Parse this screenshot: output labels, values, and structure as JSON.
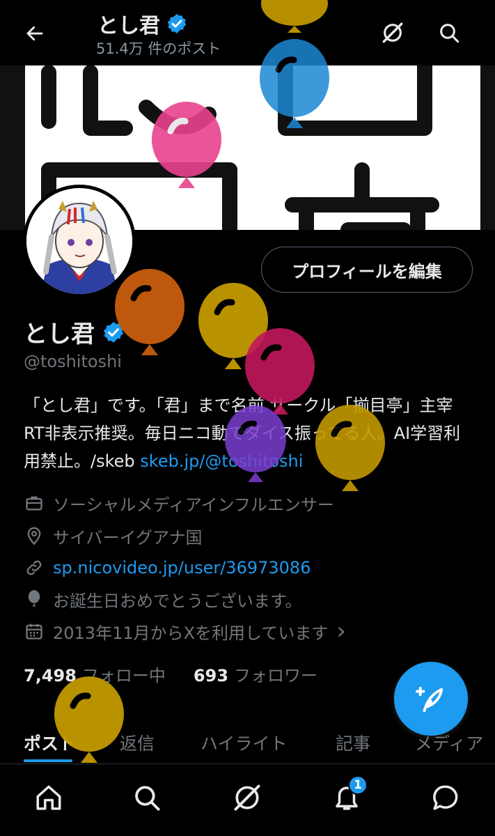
{
  "header": {
    "name": "とし君",
    "post_count": "51.4万 件のポスト",
    "icons": [
      "back-arrow-icon",
      "grok-icon",
      "search-icon"
    ]
  },
  "banner": {
    "text": "揃目亭",
    "colors": {
      "bg": "#ffffff",
      "fg": "#111111"
    }
  },
  "profile": {
    "display_name": "とし君",
    "handle": "@toshitoshi",
    "edit_button": "プロフィールを編集",
    "bio_text": "「とし君」です。「君」まで名前 サークル「揃目亭」主宰 RT非表示推奨。毎日ニコ動でダイス振ってる人。AI学習利用禁止。/skeb ",
    "bio_link": "skeb.jp/@toshitoshi",
    "category": "ソーシャルメディアインフルエンサー",
    "location": "サイバーイグアナ国",
    "website": "sp.nicovideo.jp/user/36973086",
    "birthday": "お誕生日おめでとうございます。",
    "joined": "2013年11月からXを利用しています",
    "joined_chevron": "›"
  },
  "stats": {
    "following_count": "7,498",
    "following_label": "フォロー中",
    "followers_count": "693",
    "followers_label": "フォロワー"
  },
  "tabs": [
    {
      "label": "ポスト",
      "active": true
    },
    {
      "label": "返信",
      "active": false
    },
    {
      "label": "ハイライト",
      "active": false
    },
    {
      "label": "記事",
      "active": false
    },
    {
      "label": "メディア",
      "active": false
    }
  ],
  "bottom_nav": {
    "items": [
      "home-icon",
      "search-icon",
      "grok-icon",
      "notifications-icon",
      "messages-icon"
    ],
    "notification_badge": "1"
  },
  "colors": {
    "accent": "#1d9bf0",
    "text": "#e7e9ea",
    "muted": "#71767b",
    "verified": "#1d9bf0",
    "balloons": [
      "#c39a00",
      "#1d88d4",
      "#e8428e",
      "#c85d0e",
      "#c39a00",
      "#c2185b",
      "#7b3fd0",
      "#c39a00",
      "#c39a00"
    ]
  }
}
